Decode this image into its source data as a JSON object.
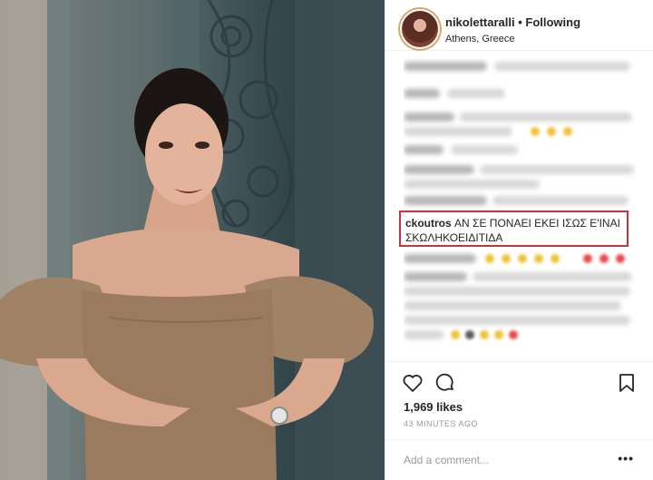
{
  "post": {
    "username": "nikolettaralli",
    "follow_separator": "•",
    "follow_status": "Following",
    "location": "Athens, Greece",
    "likes": "1,969 likes",
    "time_ago": "43 MINUTES AGO",
    "add_comment_placeholder": "Add a comment...",
    "more_label": "•••"
  },
  "highlighted_comment": {
    "username": "ckoutros",
    "text": "ΑΝ ΣΕ ΠΟΝΑΕΙ ΕΚΕΙ ΙΣΩΣ Ε'ΙΝΑΙ ΣΚΩΛΗΚΟΕΙΔΙΤΙΔΑ"
  },
  "icons": {
    "like": "heart-icon",
    "comment": "comment-bubble-icon",
    "save": "bookmark-icon"
  },
  "colors": {
    "highlight_border": "#c8343c",
    "text": "#262626",
    "muted": "#999999"
  }
}
